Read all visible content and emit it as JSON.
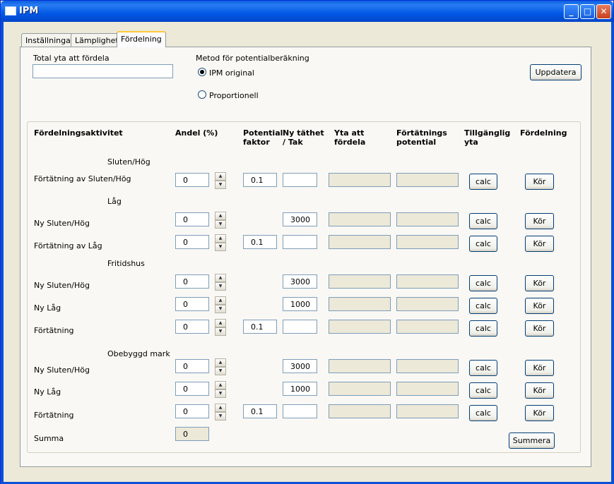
{
  "window": {
    "title": "IPM",
    "minimize": "_",
    "maximize": "□",
    "close": "✕"
  },
  "tabs": [
    "Inställningar",
    "Lämplighet",
    "Fördelning"
  ],
  "top": {
    "total_label": "Total yta att fördela",
    "total_value": "",
    "method_label": "Metod för potentialberäkning",
    "radio_ipm": "IPM original",
    "radio_prop": "Proportionell",
    "update_button": "Uppdatera"
  },
  "headers": {
    "activity": "Fördelningsaktivitet",
    "share": "Andel (%)",
    "potential": "Potential faktor",
    "density": "Ny täthet / Tak",
    "area": "Yta att fördela",
    "densification": "Förtätnings potential",
    "available": "Tillgänglig yta",
    "distribution": "Fördelning"
  },
  "groups": [
    "Sluten/Hög",
    "Låg",
    "Fritidshus",
    "Obebyggd mark"
  ],
  "rows": [
    {
      "label": "Förtätning av Sluten/Hög",
      "share": "0",
      "potential": "0.1",
      "density": ""
    },
    {
      "label": "Ny Sluten/Hög",
      "share": "0",
      "potential": null,
      "density": "3000"
    },
    {
      "label": "Förtätning av Låg",
      "share": "0",
      "potential": "0.1",
      "density": ""
    },
    {
      "label": "Ny Sluten/Hög",
      "share": "0",
      "potential": null,
      "density": "3000"
    },
    {
      "label": "Ny Låg",
      "share": "0",
      "potential": null,
      "density": "1000"
    },
    {
      "label": "Förtätning",
      "share": "0",
      "potential": "0.1",
      "density": ""
    },
    {
      "label": "Ny Sluten/Hög",
      "share": "0",
      "potential": null,
      "density": "3000"
    },
    {
      "label": "Ny Låg",
      "share": "0",
      "potential": null,
      "density": "1000"
    },
    {
      "label": "Förtätning",
      "share": "0",
      "potential": "0.1",
      "density": ""
    }
  ],
  "buttons": {
    "calc": "calc",
    "run": "Kör",
    "sum": "Summera"
  },
  "summary": {
    "label": "Summa",
    "value": "0"
  }
}
